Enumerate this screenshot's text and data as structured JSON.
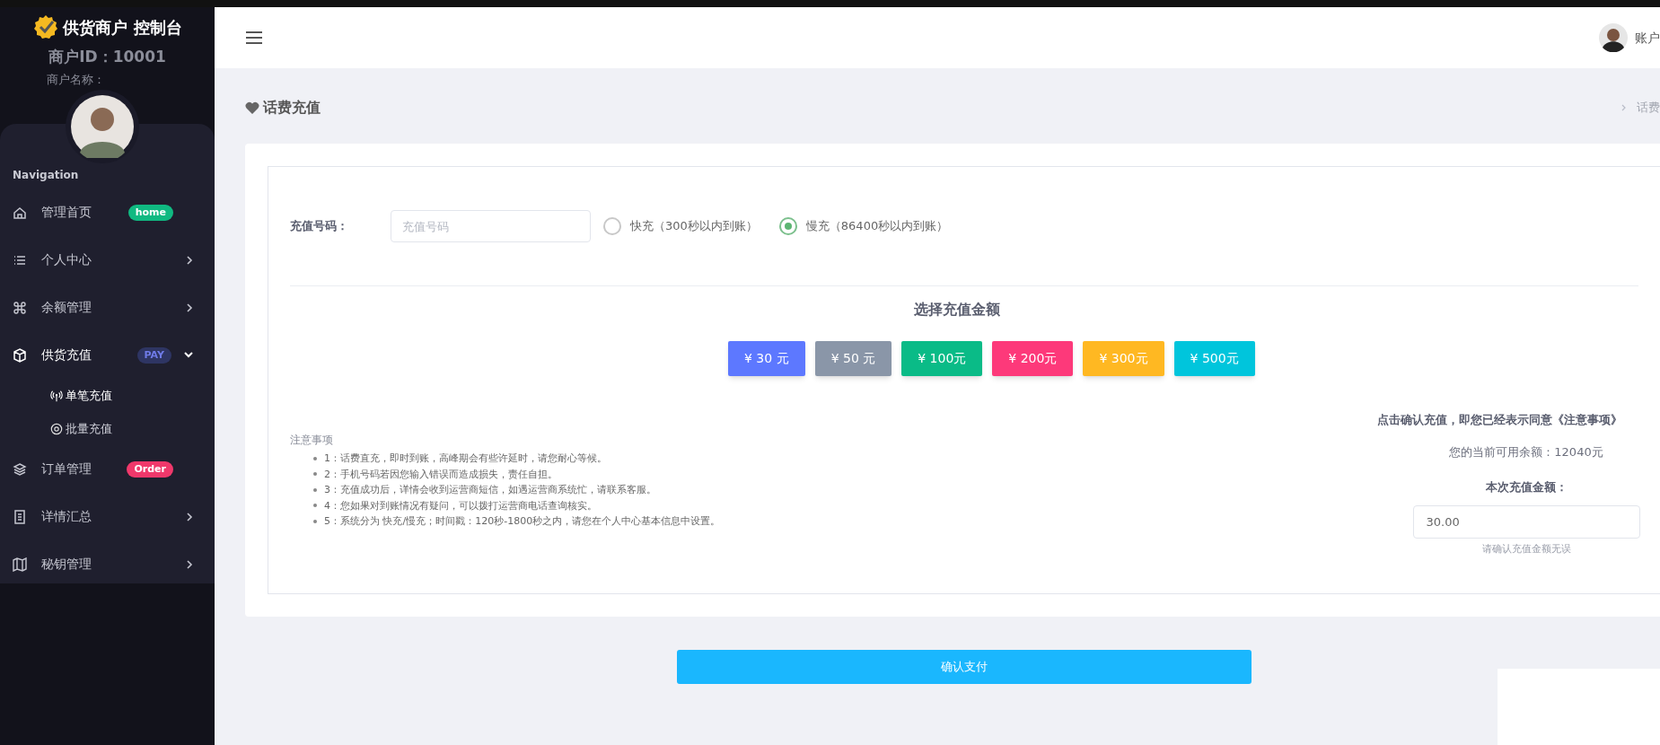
{
  "brand": {
    "title": "供货商户 控制台",
    "merchant_id": "商户ID：10001",
    "merchant_name": "商户名称："
  },
  "sidebar": {
    "heading": "Navigation",
    "items": [
      {
        "label": "管理首页",
        "selected": false,
        "badge": {
          "text": "home",
          "color": "#10b981"
        }
      },
      {
        "label": "个人中心",
        "selected": false,
        "expanded": false
      },
      {
        "label": "余额管理",
        "selected": false,
        "expanded": false
      },
      {
        "label": "供货充值",
        "selected": true,
        "expanded": true,
        "badge": {
          "text": "PAY",
          "color": "#2e3563"
        },
        "children": [
          {
            "label": "单笔充值",
            "selected": true
          },
          {
            "label": "批量充值",
            "selected": false
          }
        ]
      },
      {
        "label": "订单管理",
        "selected": false,
        "badge": {
          "text": "Order",
          "color": "#f0386b"
        }
      },
      {
        "label": "详情汇总",
        "selected": false,
        "expanded": false
      },
      {
        "label": "秘钥管理",
        "selected": false,
        "expanded": false
      }
    ]
  },
  "header": {
    "user": "账户"
  },
  "page": {
    "title": "话费充值",
    "breadcrumb": "话费"
  },
  "form": {
    "number_label": "充值号码：",
    "number_placeholder": "充值号码",
    "speeds": [
      {
        "label": "快充（300秒以内到账）",
        "selected": false
      },
      {
        "label": "慢充（86400秒以内到账）",
        "selected": true
      }
    ],
    "amount_heading": "选择充值金额",
    "amounts": [
      {
        "label": "¥ 30 元",
        "color": "#5d78ff"
      },
      {
        "label": "¥ 50 元",
        "color": "#8a96a8"
      },
      {
        "label": "¥ 100元",
        "color": "#0abb87"
      },
      {
        "label": "¥ 200元",
        "color": "#fd397a"
      },
      {
        "label": "¥ 300元",
        "color": "#ffb822"
      },
      {
        "label": "¥ 500元",
        "color": "#00c5dc"
      }
    ],
    "notes_title": "注意事项",
    "notes": [
      "1：话费直充，即时到账，高峰期会有些许延时，请您耐心等候。",
      "2：手机号码若因您输入错误而造成损失，责任自担。",
      "3：充值成功后，详情会收到运营商短信，如遇运营商系统忙，请联系客服。",
      "4：您如果对到账情况有疑问，可以拨打运营商电话查询核实。",
      "5：系统分为 快充/慢充；时间戳：120秒-1800秒之内，请您在个人中心基本信息中设置。"
    ],
    "agreement": "点击确认充值，即您已经表示同意《注意事项》",
    "balance": "您的当前可用余额：12040元",
    "amount_label": "本次充值金额：",
    "amount_value": "30.00",
    "amount_hint": "请确认充值金额无误"
  },
  "confirm_button": "确认支付"
}
